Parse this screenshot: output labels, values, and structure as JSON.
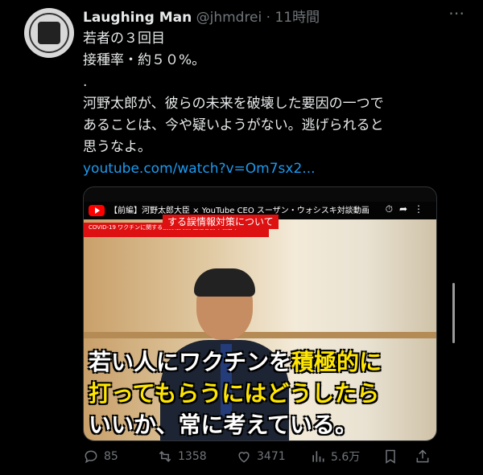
{
  "tweet": {
    "author_name": "Laughing Man",
    "handle": "@jhmdrei",
    "time": " · 11時間",
    "lines": [
      "若者の３回目",
      "接種率・約５０%。",
      ".",
      "河野太郎が、彼らの未来を破壊した要因の一つで",
      "あることは、今や疑いようがない。逃げられると",
      "思うなよ。"
    ],
    "link": "youtube.com/watch?v=Om7sx2..."
  },
  "video": {
    "title": "【前編】河野太郎大臣 × YouTube CEO スーザン・ウォシスキ対談動画",
    "banner": "する誤情報対策について",
    "mini_banner": "COVID-19 ワクチンに関する誤情報対策\n主催者側の取組み",
    "caption_line1_a": "若い人にワクチンを",
    "caption_line1_b": "積極的に",
    "caption_line2": "打ってもらうにはどうしたら",
    "caption_line3": "いいか、常に考えている。"
  },
  "actions": {
    "replies": "85",
    "retweets": "1358",
    "likes": "3471",
    "views": "5.6万"
  },
  "colors": {
    "background": "#000000",
    "link": "#1d9bf0",
    "secondary": "#71767b",
    "caption_yellow": "#ffe600",
    "banner_red": "#dd1111"
  }
}
